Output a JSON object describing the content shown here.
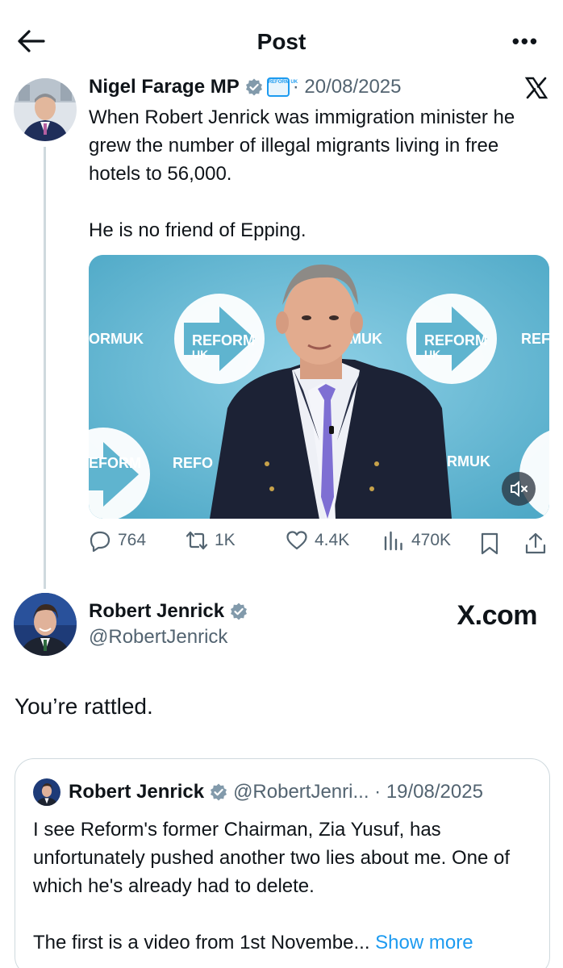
{
  "header": {
    "title": "Post",
    "back_icon": "arrow-left-icon",
    "more_icon": "more-horizontal-icon",
    "more_label": "•••"
  },
  "tweet": {
    "author": "Nigel Farage MP",
    "date": "· 20/08/2025",
    "affiliation_badge": "REFORM UK",
    "paragraphs": [
      "When Robert Jenrick was immigration minister he grew the number of illegal migrants living in free hotels to 56,000.",
      "He is no friend of Epping."
    ],
    "media_banner_words": [
      "REFORM",
      "UK"
    ],
    "stats": {
      "replies": "764",
      "reposts": "1K",
      "likes": "4.4K",
      "views": "470K"
    }
  },
  "reply": {
    "author": "Robert Jenrick",
    "handle": "@RobertJenrick",
    "watermark": "X.com",
    "text": "You’re rattled."
  },
  "quote": {
    "author": "Robert Jenrick",
    "meta": "@RobertJenri... · 19/08/2025",
    "paragraphs": [
      "I see Reform's former Chairman, Zia Yusuf, has unfortunately pushed another two lies about me. One of which he's already had to delete."
    ],
    "truncated_text": "The first is a video from 1st Novembe... ",
    "show_more": "Show more"
  },
  "colors": {
    "accent": "#1d9bf0",
    "secondary_text": "#536471",
    "border": "#cfd9de",
    "media_bg": "#5fb4cf"
  }
}
